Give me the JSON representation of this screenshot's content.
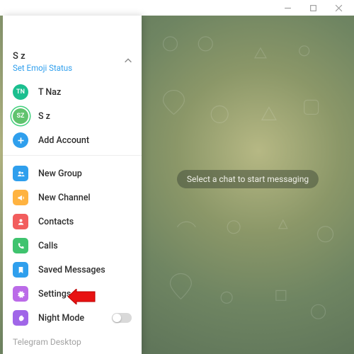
{
  "titlebar": {
    "minimize": "—",
    "maximize": "☐",
    "close": "✕"
  },
  "profile": {
    "name": "S z",
    "status": "Set Emoji Status"
  },
  "accounts": [
    {
      "initials": "TN",
      "label": "T Naz"
    },
    {
      "initials": "SZ",
      "label": "S z"
    }
  ],
  "addAccount": "Add Account",
  "menu": {
    "newGroup": "New Group",
    "newChannel": "New Channel",
    "contacts": "Contacts",
    "calls": "Calls",
    "savedMessages": "Saved Messages",
    "settings": "Settings",
    "nightMode": "Night Mode"
  },
  "footer": "Telegram Desktop",
  "main": {
    "placeholder": "Select a chat to start messaging"
  }
}
